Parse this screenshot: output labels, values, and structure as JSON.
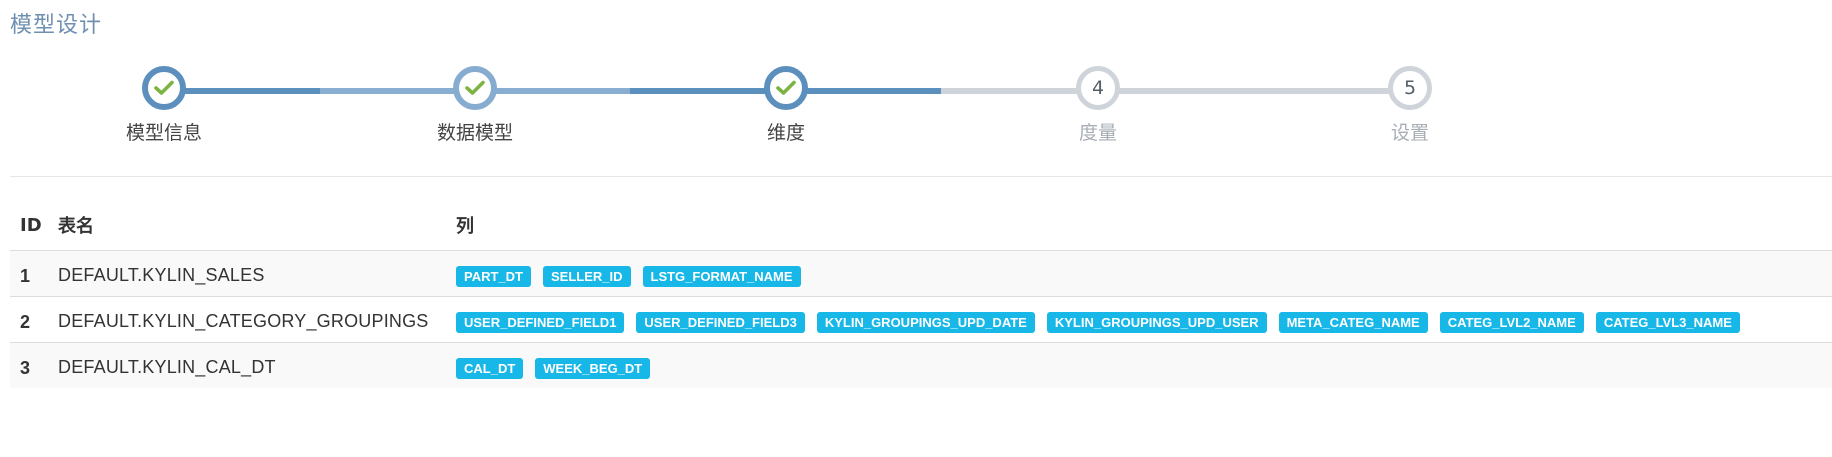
{
  "page": {
    "title": "模型设计"
  },
  "wizard": {
    "steps": [
      {
        "label": "模型信息",
        "number": "1",
        "state": "complete"
      },
      {
        "label": "数据模型",
        "number": "2",
        "state": "complete"
      },
      {
        "label": "维度",
        "number": "3",
        "state": "complete"
      },
      {
        "label": "度量",
        "number": "4",
        "state": "pending"
      },
      {
        "label": "设置",
        "number": "5",
        "state": "pending"
      }
    ],
    "colors": {
      "complete": "#5c8fbe",
      "complete_light": "#86acd0",
      "pending": "#cfd4db",
      "check": "#7cb342"
    }
  },
  "table": {
    "headers": {
      "id": "ID",
      "table_name": "表名",
      "columns": "列"
    },
    "rows": [
      {
        "id": "1",
        "table_name": "DEFAULT.KYLIN_SALES",
        "columns": [
          "PART_DT",
          "SELLER_ID",
          "LSTG_FORMAT_NAME"
        ]
      },
      {
        "id": "2",
        "table_name": "DEFAULT.KYLIN_CATEGORY_GROUPINGS",
        "columns": [
          "USER_DEFINED_FIELD1",
          "USER_DEFINED_FIELD3",
          "KYLIN_GROUPINGS_UPD_DATE",
          "KYLIN_GROUPINGS_UPD_USER",
          "META_CATEG_NAME",
          "CATEG_LVL2_NAME",
          "CATEG_LVL3_NAME"
        ]
      },
      {
        "id": "3",
        "table_name": "DEFAULT.KYLIN_CAL_DT",
        "columns": [
          "CAL_DT",
          "WEEK_BEG_DT"
        ]
      }
    ],
    "tag_color": "#17b7e8"
  }
}
